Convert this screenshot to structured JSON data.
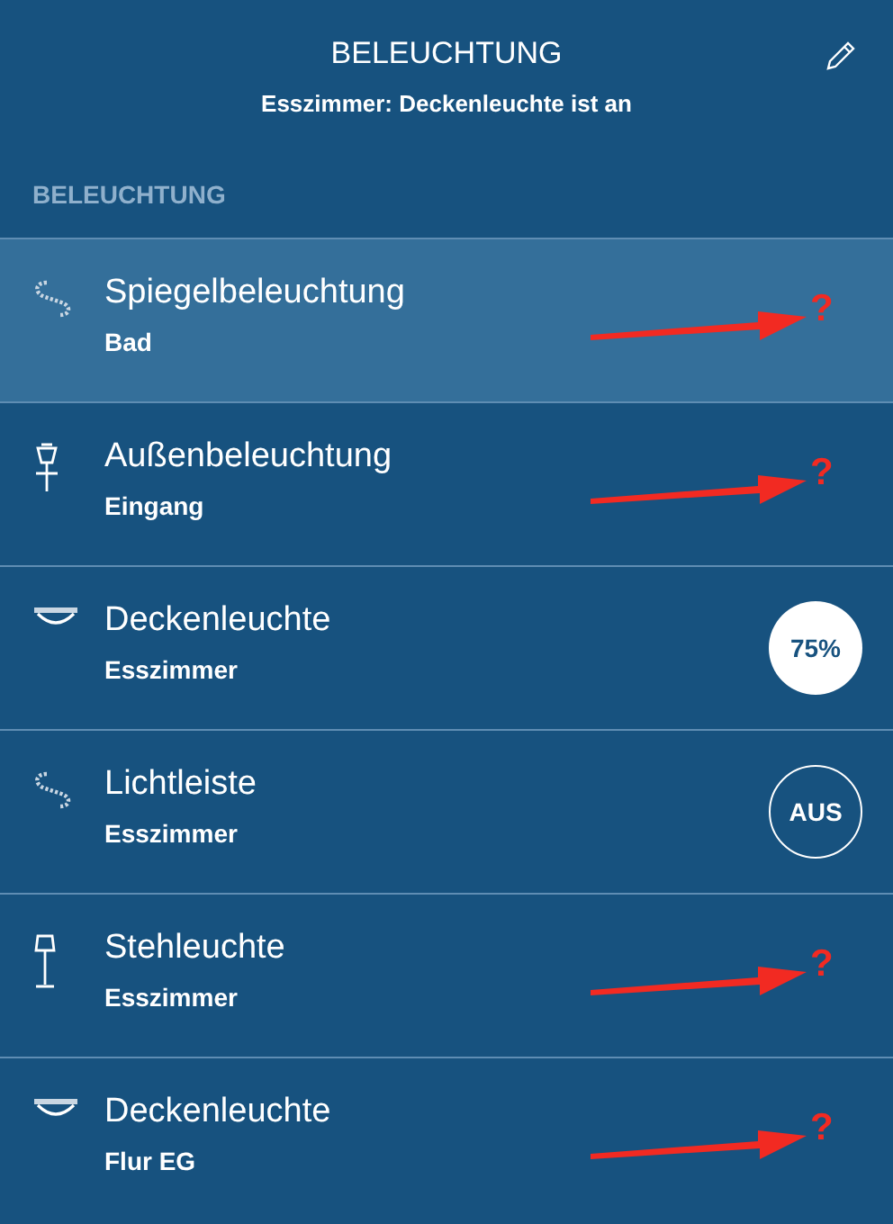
{
  "header": {
    "title": "BELEUCHTUNG",
    "subtitle": "Esszimmer: Deckenleuchte ist an"
  },
  "section": {
    "label": "BELEUCHTUNG"
  },
  "lights": [
    {
      "name": "Spiegelbeleuchtung",
      "room": "Bad",
      "kind": "strip",
      "selected": true,
      "annotation": {
        "kind": "arrow",
        "text": "?"
      }
    },
    {
      "name": "Außenbeleuchtung",
      "room": "Eingang",
      "kind": "lantern",
      "selected": false,
      "annotation": {
        "kind": "arrow",
        "text": "?"
      }
    },
    {
      "name": "Deckenleuchte",
      "room": "Esszimmer",
      "kind": "ceiling",
      "selected": false,
      "status": {
        "kind": "on",
        "text": "75%"
      }
    },
    {
      "name": "Lichtleiste",
      "room": "Esszimmer",
      "kind": "strip",
      "selected": false,
      "status": {
        "kind": "off",
        "text": "AUS"
      }
    },
    {
      "name": "Stehleuchte",
      "room": "Esszimmer",
      "kind": "floor",
      "selected": false,
      "annotation": {
        "kind": "arrow",
        "text": "?"
      }
    },
    {
      "name": "Deckenleuchte",
      "room": "Flur EG",
      "kind": "ceiling",
      "selected": false,
      "annotation": {
        "kind": "arrow",
        "text": "?"
      }
    }
  ]
}
